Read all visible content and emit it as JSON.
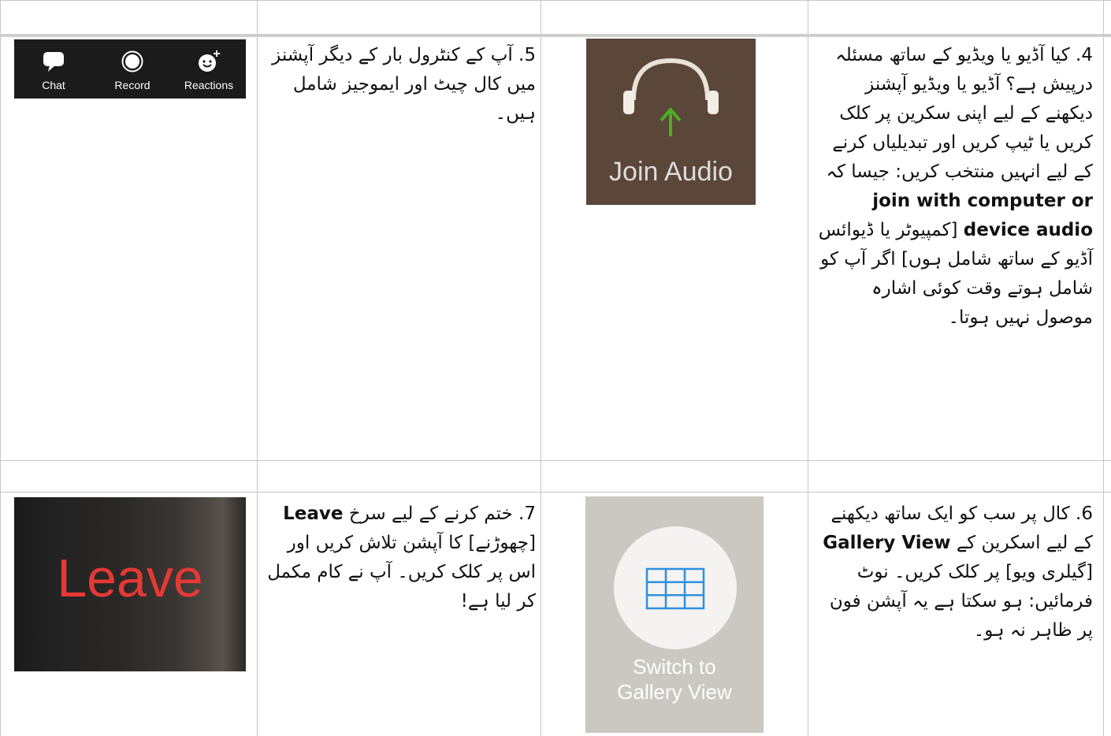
{
  "row_top": {
    "toolbar": {
      "chat_label": "Chat",
      "record_label": "Record",
      "reactions_label": "Reactions"
    },
    "step5_text": "5. آپ کے کنٹرول بار کے دیگر آپشنز میں کال چیٹ اور ایموجیز شامل ہیں۔",
    "join_audio_label": "Join Audio",
    "step4": {
      "text_a": "4. کیا آڈیو یا ویڈیو کے ساتھ مسئلہ درپیش ہے؟ آڈیو یا ویڈیو آپشنز دیکھنے کے لیے اپنی سکرین پر کلک کریں یا ٹیپ کریں اور تبدیلیاں کرنے کے لیے انہیں منتخب کریں: جیسا کہ",
      "bold": "join with computer or device audio",
      "text_b": "[کمپیوٹر یا ڈیوائس آڈیو کے ساتھ شامل ہوں] اگر آپ کو شامل ہوتے وقت کوئی اشارہ موصول نہیں ہوتا۔"
    }
  },
  "row_bottom": {
    "leave_label": "Leave",
    "step7": {
      "text_a": "7. ختم کرنے کے لیے سرخ",
      "bold": "Leave",
      "text_b": "[چھوڑنے] کا آپشن تلاش کریں اور اس پر کلک کریں۔ آپ نے کام مکمل کر لیا ہے!"
    },
    "gallery_label_1": "Switch to",
    "gallery_label_2": "Gallery View",
    "step6": {
      "text_a": "6. کال پر سب کو ایک ساتھ دیکھنے کے لیے اسکرین کے",
      "bold": "Gallery View",
      "text_b": "[گیلری ویو] پر کلک کریں۔ نوٹ فرمائیں: ہو سکتا ہے یہ آپشن فون پر ظاہر نہ ہو۔"
    }
  },
  "colors": {
    "grid": "#c6c6c6",
    "leave_red": "#e53935",
    "audio_bg": "#5b463a",
    "arrow_green": "#4caf1e",
    "gallery_blue": "#2f8fe0"
  }
}
